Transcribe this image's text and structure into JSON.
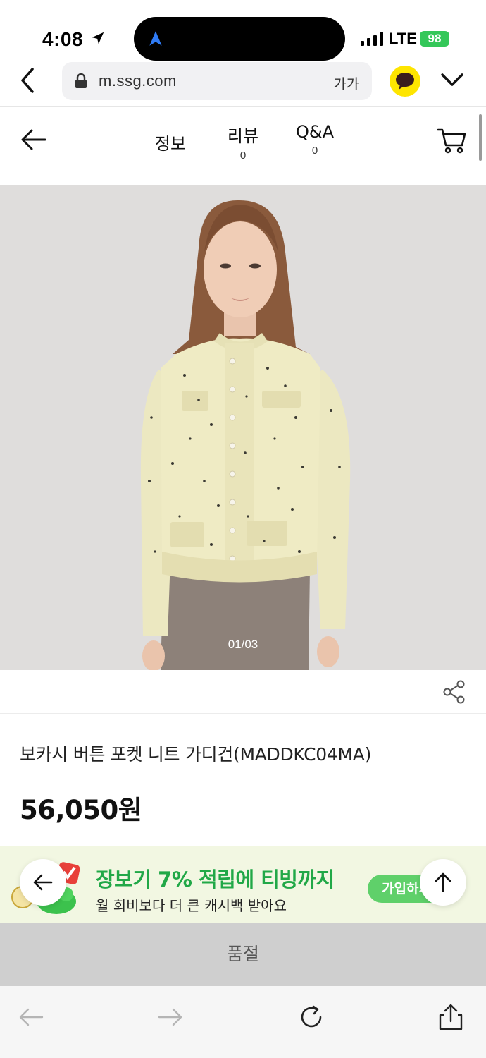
{
  "status_bar": {
    "time": "4:08",
    "network": "LTE",
    "battery": "98"
  },
  "browser": {
    "url": "m.ssg.com",
    "text_size_label": "가가"
  },
  "product_tabs": [
    {
      "label": "정보"
    },
    {
      "label": "리뷰",
      "count": "0"
    },
    {
      "label": "Q&A",
      "count": "0"
    }
  ],
  "gallery": {
    "page_indicator": "01/03"
  },
  "product": {
    "title": "보카시 버튼 포켓 니트 가디건(MADDKC04MA)",
    "price": "56,050원"
  },
  "promo": {
    "headline": "장보기 7% 적립에 티빙까지",
    "subtext": "월 회비보다 더 큰 캐시백 받아요",
    "button_label": "가입하기"
  },
  "purchase": {
    "status_label": "품절"
  },
  "colors": {
    "accent_green": "#21a847",
    "promo_bg": "#f2f7e2",
    "soldout_bg": "#cfcfcf",
    "kakao_yellow": "#fee500"
  }
}
